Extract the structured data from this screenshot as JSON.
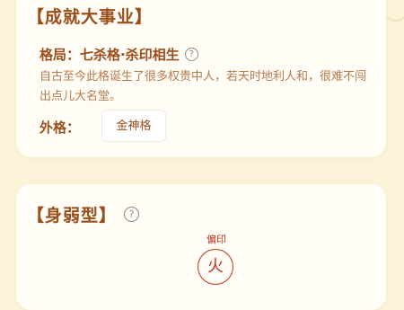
{
  "top_card": {
    "title": "【成就大事业】",
    "pattern_label": "格局：",
    "pattern_value": "七杀格·杀印相生",
    "description": "自古至今此格诞生了很多权贵中人，若天时地利人和，很难不闯出点儿大名堂。",
    "outer_label": "外格：",
    "outer_chip": "金神格"
  },
  "bottom_card": {
    "title": "【身弱型】",
    "top_label": "偏印",
    "element": "火"
  },
  "icons": {
    "help": "question-circle-icon"
  },
  "colors": {
    "background": "#fbf3d8",
    "card": "#fffdf6",
    "title": "#9a4e1a",
    "description": "#b87a4b",
    "element_red": "#c0311a"
  }
}
